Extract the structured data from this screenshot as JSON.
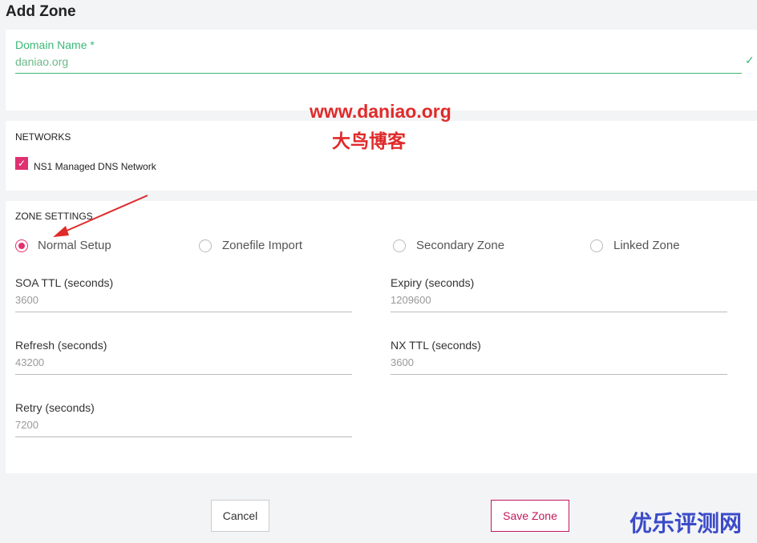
{
  "title": "Add Zone",
  "domain": {
    "label": "Domain Name *",
    "value": "daniao.org"
  },
  "networks": {
    "heading": "NETWORKS",
    "items": [
      {
        "label": "NS1 Managed DNS Network",
        "checked": true
      }
    ]
  },
  "zone_settings": {
    "heading": "ZONE SETTINGS",
    "options": [
      {
        "label": "Normal Setup",
        "selected": true
      },
      {
        "label": "Zonefile Import",
        "selected": false
      },
      {
        "label": "Secondary Zone",
        "selected": false
      },
      {
        "label": "Linked Zone",
        "selected": false
      }
    ],
    "fields": {
      "soa_ttl": {
        "label": "SOA TTL (seconds)",
        "value": "3600"
      },
      "expiry": {
        "label": "Expiry (seconds)",
        "value": "1209600"
      },
      "refresh": {
        "label": "Refresh (seconds)",
        "value": "43200"
      },
      "nx_ttl": {
        "label": "NX TTL (seconds)",
        "value": "3600"
      },
      "retry": {
        "label": "Retry (seconds)",
        "value": "7200"
      }
    }
  },
  "buttons": {
    "cancel": "Cancel",
    "save": "Save Zone"
  },
  "watermarks": {
    "site": "www.daniao.org",
    "site_cn": "大鸟博客",
    "corner": "优乐评测网"
  },
  "colors": {
    "accent": "#e0306f",
    "valid": "#3cb878"
  }
}
